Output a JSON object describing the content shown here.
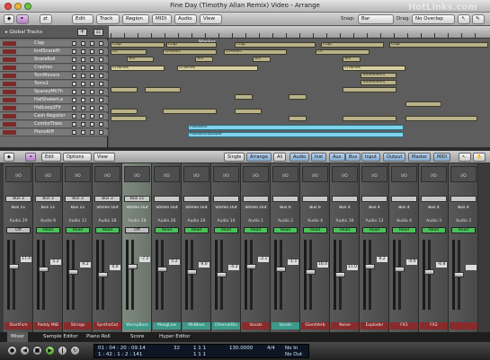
{
  "window": {
    "title": "Fine Day (Timothy Allan Remix) Video - Arrange"
  },
  "toolbar": {
    "edit": "Edit",
    "track": "Track",
    "region": "Region",
    "midi": "MIDI",
    "audio": "Audio",
    "view": "View",
    "snap_label": "Snap:",
    "snap_value": "Bar",
    "drag_label": "Drag:",
    "drag_value": "No Overlap"
  },
  "watermark": "HotLinks.com",
  "tracks_header": {
    "label": "Global Tracks"
  },
  "marker": "Marker",
  "tracks": [
    {
      "name": "Clap"
    },
    {
      "name": "kndSnareHi"
    },
    {
      "name": "SnareRoll"
    },
    {
      "name": "Crashes"
    },
    {
      "name": "TomMovers"
    },
    {
      "name": "Toms1"
    },
    {
      "name": "SpaceyMhTh"
    },
    {
      "name": "HatShakerLa"
    },
    {
      "name": "HatLoop2Fir"
    },
    {
      "name": "Cash Register"
    },
    {
      "name": "ComboThwa"
    },
    {
      "name": "PianoRiff"
    }
  ],
  "regions": [
    {
      "label": "Clap"
    },
    {
      "label": "Clap"
    },
    {
      "label": "Clap"
    },
    {
      "label": "Clap"
    },
    {
      "label": "Clap"
    },
    {
      "label": "Cli"
    },
    {
      "label": "Clrevert"
    },
    {
      "label": "Clrevert"
    },
    {
      "label": "Cli"
    },
    {
      "label": "Sni"
    },
    {
      "label": "Sni"
    },
    {
      "label": "Sni"
    },
    {
      "label": "Sni"
    },
    {
      "label": "Crashes"
    },
    {
      "label": "Crashes"
    },
    {
      "label": "Crashes"
    },
    {
      "label": "TomMovers"
    },
    {
      "label": "TomMovers"
    },
    {
      "label": "PianoRiff"
    },
    {
      "label": "PianoRiffDouble"
    }
  ],
  "mixer_toolbar": {
    "edit": "Edit",
    "options": "Options",
    "view": "View",
    "single": "Single",
    "arrange": "Arrange",
    "all": "All",
    "audio": "Audio",
    "inst": "Inst",
    "aux": "Aux",
    "bus": "Bus",
    "input": "Input",
    "output": "Output",
    "master": "Master",
    "midi": "MIDI"
  },
  "strips": [
    {
      "io": "I/O",
      "bus": "Bus 3",
      "out": "Bus 11",
      "ch": "Audio 29",
      "mode": "Off",
      "val": "17.4",
      "name": "StartFsm",
      "color": "#8a2a2a"
    },
    {
      "io": "I/O",
      "bus": "Bus 3",
      "out": "Bus 11",
      "ch": "Audio 9",
      "mode": "Read",
      "val": "5.2",
      "name": "Paddy MiB",
      "color": "#8a2a2a"
    },
    {
      "io": "I/O",
      "bus": "Bus 3",
      "out": "Bus 11",
      "ch": "Audio 11",
      "mode": "Read",
      "val": "9.2",
      "name": "Strings",
      "color": "#8a2a2a"
    },
    {
      "io": "I/O",
      "bus": "Bus 3",
      "out": "Stereo Out",
      "ch": "Audio 28",
      "mode": "Read",
      "val": "0.0",
      "name": "SynthsOut",
      "color": "#8a2a2a"
    },
    {
      "io": "I/O",
      "bus": "Bus 11",
      "out": "Stereo Out",
      "ch": "Audio 28",
      "mode": "Off",
      "val": "-7.2",
      "name": "WompBass",
      "color": "#3b9a8a",
      "sel": true
    },
    {
      "io": "I/O",
      "bus": "",
      "out": "Stereo Out",
      "ch": "Audio 26",
      "mode": "Read",
      "val": "5.2",
      "name": "MoogLow",
      "color": "#3b9a8a"
    },
    {
      "io": "I/O",
      "bus": "",
      "out": "Stereo Out",
      "ch": "Audio 26",
      "mode": "Read",
      "val": "9.0",
      "name": "MidBass",
      "color": "#3b9a8a"
    },
    {
      "io": "I/O",
      "bus": "",
      "out": "Stereo Out",
      "ch": "Audio 14",
      "mode": "Read",
      "val": "-4.3",
      "name": "EtherialDiv",
      "color": "#3b9a8a"
    },
    {
      "io": "I/O",
      "bus": "",
      "out": "Stereo Out",
      "ch": "Audio 1",
      "mode": "Read",
      "val": "-2.1",
      "name": "Vocals",
      "color": "#8a2a2a"
    },
    {
      "io": "I/O",
      "bus": "",
      "out": "Bus 6",
      "ch": "Audio 2",
      "mode": "Read",
      "val": "-1.1",
      "name": "Vocals",
      "color": "#3b9a8a"
    },
    {
      "io": "I/O",
      "bus": "",
      "out": "Bus 6",
      "ch": "Audio 4",
      "mode": "Read",
      "val": "16.4",
      "name": "GiantVerb",
      "color": "#8a2a2a"
    },
    {
      "io": "I/O",
      "bus": "",
      "out": "Bus 4",
      "ch": "Audio 30",
      "mode": "Read",
      "val": "11.0",
      "name": "Noise",
      "color": "#8a2a2a"
    },
    {
      "io": "I/O",
      "bus": "",
      "out": "Bus 4",
      "ch": "Audio 13",
      "mode": "Read",
      "val": "9.2",
      "name": "Exploder",
      "color": "#8a2a2a"
    },
    {
      "io": "I/O",
      "bus": "",
      "out": "Bus 4",
      "ch": "Audio 4",
      "mode": "Read",
      "val": "-4.4",
      "name": "FX1",
      "color": "#8a2a2a"
    },
    {
      "io": "I/O",
      "bus": "",
      "out": "Bus 4",
      "ch": "Audio 3",
      "mode": "Read",
      "val": "-6.8",
      "name": "FX2",
      "color": "#8a2a2a"
    },
    {
      "io": "I/O",
      "bus": "",
      "out": "Bus 4",
      "ch": "Audio 3",
      "mode": "Read",
      "val": "",
      "name": "",
      "color": "#8a2a2a"
    }
  ],
  "bottom_tabs": {
    "mixer": "Mixer",
    "sample_editor": "Sample Editor",
    "piano_roll": "Piano Roll",
    "score": "Score",
    "hyper_editor": "Hyper Editor"
  },
  "transport": {
    "time": "01 : 04 : 20 : 09.14",
    "bars": "1 : 42 : 1 : 2 : 141",
    "pos1": "32",
    "pos2": "1 1 1",
    "pos3": "1 1 1",
    "tempo": "130.0000",
    "sig": "4/4",
    "in": "No In",
    "out": "No Out",
    "extra1": "1",
    "extra2": "1"
  }
}
